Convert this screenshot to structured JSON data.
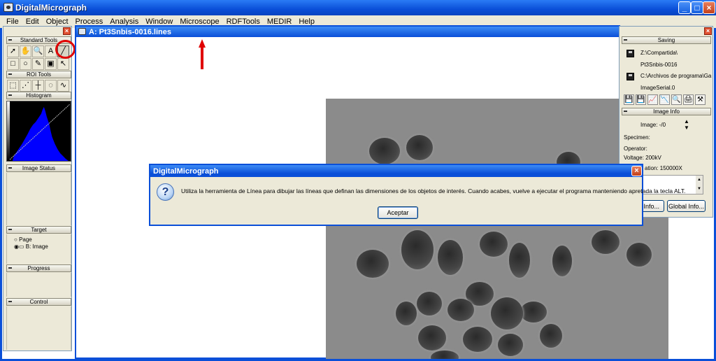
{
  "app": {
    "title": "DigitalMicrograph",
    "window_controls": {
      "minimize": "_",
      "maximize": "□",
      "close": "×"
    }
  },
  "menu": [
    "File",
    "Edit",
    "Object",
    "Process",
    "Analysis",
    "Window",
    "Microscope",
    "RDFTools",
    "MEDIR",
    "Help"
  ],
  "left_panel": {
    "close": "×",
    "standard_tools": {
      "title": "Standard Tools",
      "tools": [
        {
          "name": "pointer",
          "glyph": "➚"
        },
        {
          "name": "hand",
          "glyph": "✋"
        },
        {
          "name": "zoom",
          "glyph": "🔍"
        },
        {
          "name": "text",
          "glyph": "A"
        },
        {
          "name": "line",
          "glyph": "╱"
        },
        {
          "name": "rectangle",
          "glyph": "□"
        },
        {
          "name": "oval",
          "glyph": "○"
        },
        {
          "name": "wand",
          "glyph": "✎"
        },
        {
          "name": "image-info",
          "glyph": "▣"
        },
        {
          "name": "cursor",
          "glyph": "↖"
        }
      ]
    },
    "roi_tools": {
      "title": "ROI Tools",
      "tools": [
        {
          "name": "roi-rect",
          "glyph": "⬚"
        },
        {
          "name": "roi-line",
          "glyph": "⋰"
        },
        {
          "name": "roi-point",
          "glyph": "┼"
        },
        {
          "name": "roi-lasso",
          "glyph": "◌"
        },
        {
          "name": "roi-curve",
          "glyph": "∿"
        }
      ]
    },
    "histogram": {
      "title": "Histogram"
    },
    "image_status": {
      "title": "Image Status"
    },
    "target": {
      "title": "Target",
      "options": [
        {
          "label": "Page",
          "selected": false
        },
        {
          "label": "B: Image",
          "selected": true
        }
      ]
    },
    "progress": {
      "title": "Progress"
    },
    "control": {
      "title": "Control"
    }
  },
  "image_window": {
    "title": "A: Pt3Snbis-0016.lines"
  },
  "right_panel": {
    "close": "×",
    "saving": {
      "title": "Saving",
      "path1": "Z:\\Compartida\\",
      "name1": "Pt3Snbis-0016",
      "path2": "C:\\Archivos de programa\\Ga",
      "name2": "ImageSerial.0",
      "icons": [
        "💾",
        "💾",
        "📈",
        "📉",
        "🔍",
        "🖨",
        "⚒"
      ]
    },
    "image_info": {
      "title": "Image Info",
      "image_label": "Image: -/0",
      "specimen": "Specimen:",
      "operator": "Operator:",
      "voltage": "Voltage: 200kV",
      "magnification": "ation: 150000X",
      "image_info_button": "e Info...",
      "global_info_button": "Global Info..."
    }
  },
  "dialog": {
    "title": "DigitalMicrograph",
    "close": "×",
    "icon": "?",
    "message": "Utiliza la herramienta de Línea para dibujar las líneas que definan las dimensiones de los objetos de interés. Cuando acabes, vuelve a ejecutar el programa manteniendo apretada la tecla ALT.",
    "ok_button": "Aceptar"
  },
  "colors": {
    "xp_blue": "#0a4fd8",
    "panel": "#ece9d8",
    "annotation_red": "#e00000",
    "histogram_blue": "#0000ff"
  }
}
